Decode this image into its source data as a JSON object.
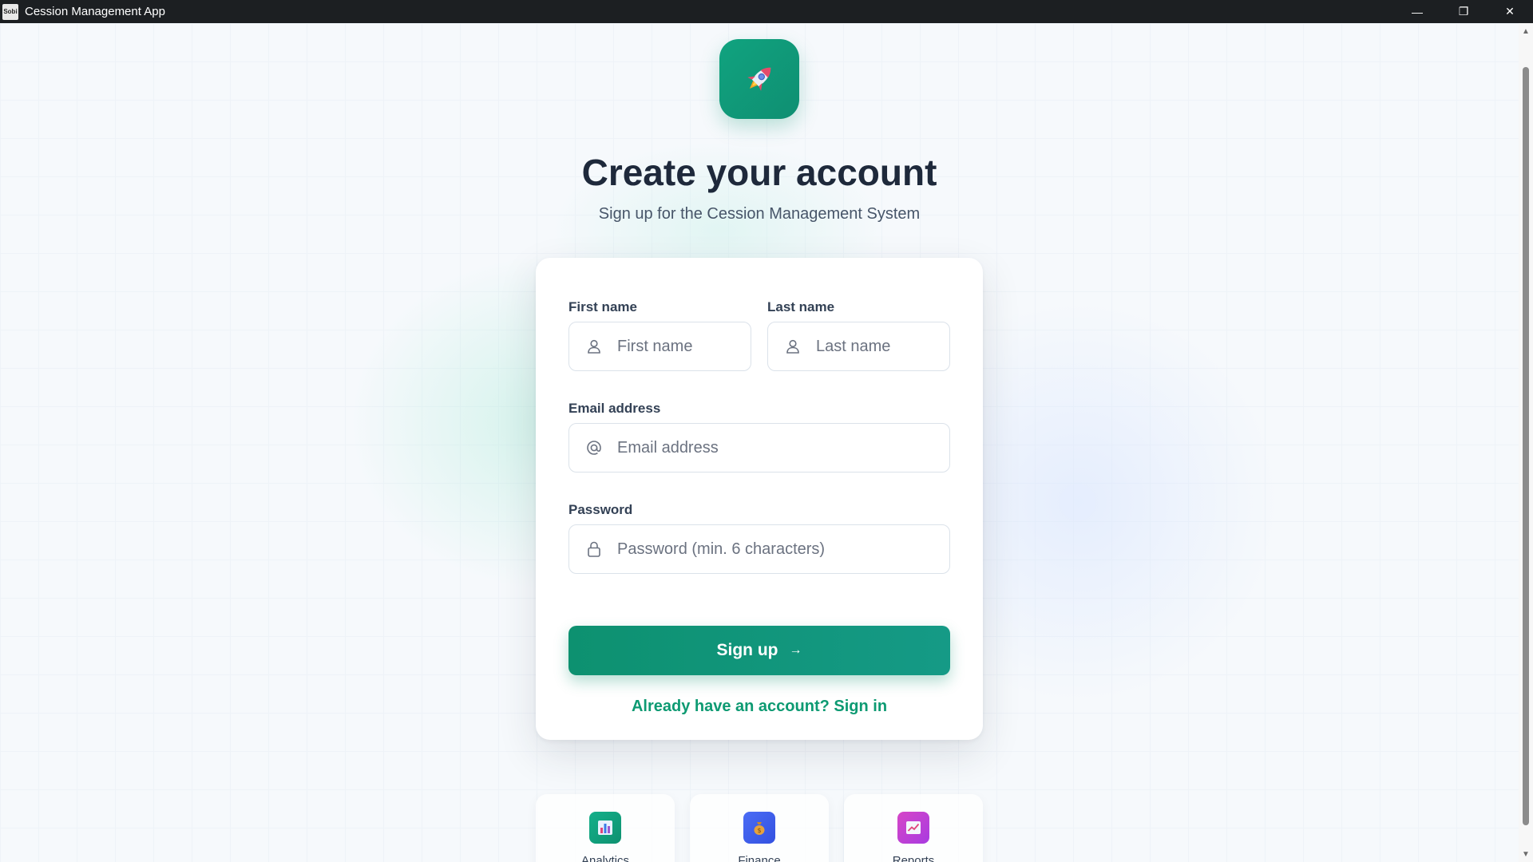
{
  "window": {
    "app_icon_text": "Sobi",
    "title": "Cession Management App",
    "minimize_glyph": "—",
    "restore_glyph": "❐",
    "close_glyph": "✕"
  },
  "scrollbar": {
    "up_glyph": "▲",
    "down_glyph": "▼"
  },
  "logo": {
    "icon": "rocket-icon"
  },
  "heading": "Create your account",
  "subheading": "Sign up for the Cession Management System",
  "form": {
    "first_name": {
      "label": "First name",
      "placeholder": "First name",
      "icon": "user-icon"
    },
    "last_name": {
      "label": "Last name",
      "placeholder": "Last name",
      "icon": "user-icon"
    },
    "email": {
      "label": "Email address",
      "placeholder": "Email address",
      "icon": "at-icon"
    },
    "password": {
      "label": "Password",
      "placeholder": "Password (min. 6 characters)",
      "icon": "lock-icon"
    },
    "submit_label": "Sign up",
    "submit_arrow": "→",
    "signin_link": "Already have an account? Sign in"
  },
  "features": [
    {
      "label": "Analytics",
      "icon": "bar-chart-icon",
      "color": "#10a37f"
    },
    {
      "label": "Finance",
      "icon": "money-bag-icon",
      "color": "#3b5bf0"
    },
    {
      "label": "Reports",
      "icon": "trend-chart-icon",
      "color": "#c43fd6"
    }
  ],
  "colors": {
    "accent": "#0d9a72",
    "button": "#0d9170",
    "heading": "#1e293b"
  }
}
